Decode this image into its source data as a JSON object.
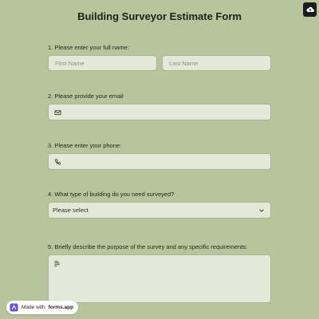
{
  "form": {
    "title": "Building Surveyor Estimate Form"
  },
  "questions": {
    "q1": {
      "label": "1.  Please enter your full name:",
      "first_placeholder": "First Name",
      "last_placeholder": "Last Name"
    },
    "q2": {
      "label": "2. Please provide your email",
      "icon": "mail-icon"
    },
    "q3": {
      "label": "3. Please enter your phone:",
      "icon": "phone-icon"
    },
    "q4": {
      "label": "4. What type of building do you need surveyed?",
      "selected": "Please select"
    },
    "q5": {
      "label": "5. Briefly describe the purpose of the survey and any specific requirements:",
      "icon": "text-lines-icon"
    }
  },
  "badge": {
    "prefix": "Made with",
    "brand": "forms.app"
  },
  "colors": {
    "background": "#b7c59d",
    "field": "#e4e8d9",
    "border": "#a9b494",
    "text": "#1f2418"
  }
}
